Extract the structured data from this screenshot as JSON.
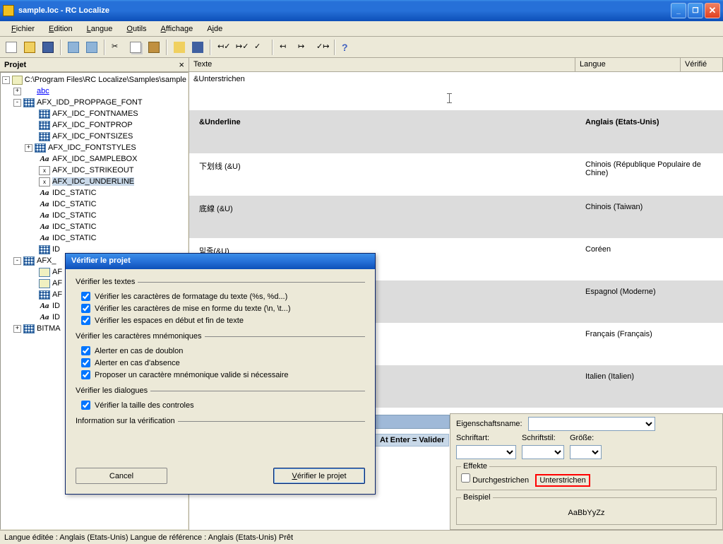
{
  "window": {
    "title": "sample.loc - RC Localize"
  },
  "menu": {
    "file": "Fichier",
    "edit": "Edition",
    "lang": "Langue",
    "tools": "Outils",
    "view": "Affichage",
    "help": "Aide"
  },
  "project_panel": {
    "title": "Projet"
  },
  "tree": {
    "root": "C:\\Program Files\\RC Localize\\Samples\\sample",
    "abc": "abc",
    "items": [
      "AFX_IDD_PROPPAGE_FONT",
      "AFX_IDC_FONTNAMES",
      "AFX_IDC_FONTPROP",
      "AFX_IDC_FONTSIZES",
      "AFX_IDC_FONTSTYLES",
      "AFX_IDC_SAMPLEBOX",
      "AFX_IDC_STRIKEOUT",
      "AFX_IDC_UNDERLINE",
      "IDC_STATIC",
      "IDC_STATIC",
      "IDC_STATIC",
      "IDC_STATIC",
      "IDC_STATIC",
      "ID",
      "AFX_",
      "AF",
      "AF",
      "AF",
      "ID",
      "ID",
      "BITMA"
    ]
  },
  "listheader": {
    "texte": "Texte",
    "langue": "Langue",
    "verifie": "Vérifié"
  },
  "edit_text": "&Unterstrichen",
  "rows": [
    {
      "text": "&Underline",
      "lang": "Anglais (Etats-Unis)"
    },
    {
      "text": "下划线 (&U)",
      "lang": "Chinois (République Populaire de Chine)"
    },
    {
      "text": "底線 (&U)",
      "lang": "Chinois (Taiwan)"
    },
    {
      "text": "밑줄(&U)",
      "lang": "Coréen"
    },
    {
      "text": "",
      "lang": "Espagnol (Moderne)"
    },
    {
      "text": "",
      "lang": "Français (Français)"
    },
    {
      "text": "",
      "lang": "Italien (Italien)"
    }
  ],
  "dialog": {
    "title": "Vérifier le projet",
    "g1": "Vérifier les textes",
    "c1": "Vérifier les caractères de formatage du texte (%s, %d...)",
    "c2": "Vérifier les caractères de mise en forme du texte (\\n, \\t...)",
    "c3": "Vérifier les espaces en début et fin de texte",
    "g2": "Vérifier les caractères mnémoniques",
    "c4": "Alerter en cas de doublon",
    "c5": "Alerter en cas d'absence",
    "c6": "Proposer un caractère mnémonique valide si nécessaire",
    "g3": "Vérifier les dialogues",
    "c7": "Vérifier la taille des controles",
    "g4": "Information sur la vérification",
    "cancel": "Cancel",
    "verify": "Vérifier le projet"
  },
  "preview": {
    "prop_label": "Eigenschaftsname:",
    "font_label": "Schriftart:",
    "style_label": "Schriftstil:",
    "size_label": "Größe:",
    "effects": "Effekte",
    "strike": "Durchgestrichen",
    "underline": "Unterstrichen",
    "sample_label": "Beispiel",
    "sample_text": "AaBbYyZz"
  },
  "hint": "At     Enter = Valider",
  "status": "Langue éditée : Anglais (Etats-Unis)   Langue de référence : Anglais (Etats-Unis) Prêt"
}
